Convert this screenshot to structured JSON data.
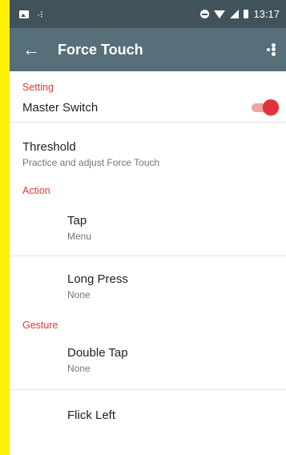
{
  "status_bar": {
    "time": "13:17"
  },
  "toolbar": {
    "title": "Force Touch",
    "back_icon": "arrow-left-icon",
    "menu_icon": "more-vert-icon"
  },
  "sections": {
    "setting": {
      "header": "Setting",
      "master_switch": {
        "label": "Master Switch",
        "enabled": true,
        "accent": "#e53139"
      },
      "threshold": {
        "title": "Threshold",
        "subtitle": "Practice and adjust Force Touch"
      }
    },
    "action": {
      "header": "Action",
      "items": [
        {
          "title": "Tap",
          "subtitle": "Menu"
        },
        {
          "title": "Long Press",
          "subtitle": "None"
        }
      ]
    },
    "gesture": {
      "header": "Gesture",
      "items": [
        {
          "title": "Double Tap",
          "subtitle": "None"
        },
        {
          "title": "Flick Left",
          "subtitle": ""
        }
      ]
    }
  },
  "colors": {
    "status_bar": "#41535a",
    "toolbar": "#566f78",
    "accent": "#e0393e",
    "frame": "#fff200"
  }
}
